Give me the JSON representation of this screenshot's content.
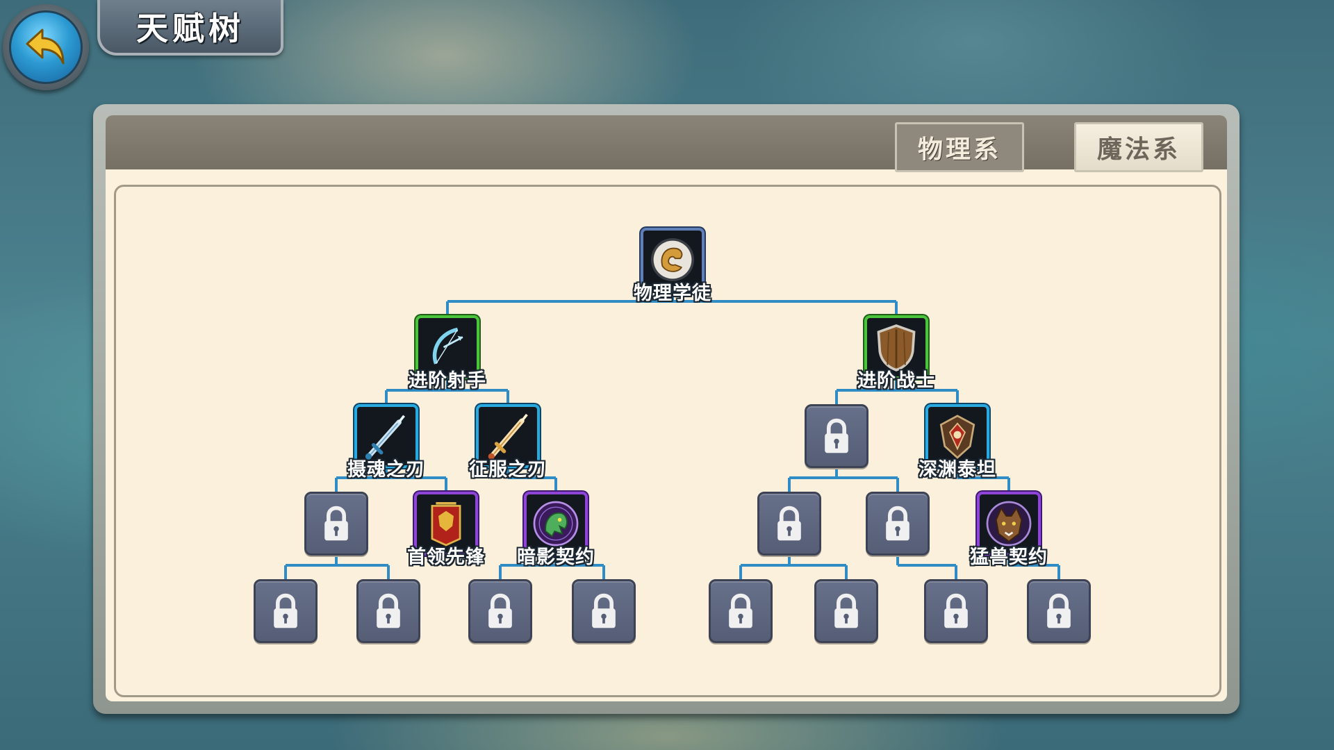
{
  "header": {
    "title": "天赋树"
  },
  "tabs": [
    {
      "label": "物理系",
      "active": true
    },
    {
      "label": "魔法系",
      "active": false
    }
  ],
  "tree": {
    "line_color": "#2f8cc4",
    "nodes": [
      {
        "id": "n1",
        "label": "物理学徒",
        "state": "unlocked",
        "frame": "blue",
        "icon": "fist-icon"
      },
      {
        "id": "n2",
        "label": "进阶射手",
        "state": "unlocked",
        "frame": "green",
        "icon": "bow-icon"
      },
      {
        "id": "n3",
        "label": "进阶战士",
        "state": "unlocked",
        "frame": "green",
        "icon": "shield-icon"
      },
      {
        "id": "n4",
        "label": "摄魂之刃",
        "state": "unlocked",
        "frame": "cyan",
        "icon": "sword-icon"
      },
      {
        "id": "n5",
        "label": "征服之刃",
        "state": "unlocked",
        "frame": "cyan",
        "icon": "golden-sword-icon"
      },
      {
        "id": "n6",
        "label": "",
        "state": "locked",
        "icon": "lock-icon"
      },
      {
        "id": "n7",
        "label": "深渊泰坦",
        "state": "unlocked",
        "frame": "cyan",
        "icon": "titan-crest-icon"
      },
      {
        "id": "n8",
        "label": "",
        "state": "locked",
        "icon": "lock-icon"
      },
      {
        "id": "n9",
        "label": "首领先锋",
        "state": "unlocked",
        "frame": "purple",
        "icon": "banner-icon"
      },
      {
        "id": "n10",
        "label": "暗影契约",
        "state": "unlocked",
        "frame": "purple",
        "icon": "dragon-icon"
      },
      {
        "id": "n11",
        "label": "",
        "state": "locked",
        "icon": "lock-icon"
      },
      {
        "id": "n12",
        "label": "",
        "state": "locked",
        "icon": "lock-icon"
      },
      {
        "id": "n13",
        "label": "猛兽契约",
        "state": "unlocked",
        "frame": "purple",
        "icon": "beast-icon"
      },
      {
        "id": "n14",
        "label": "",
        "state": "locked",
        "icon": "lock-icon"
      },
      {
        "id": "n15",
        "label": "",
        "state": "locked",
        "icon": "lock-icon"
      },
      {
        "id": "n16",
        "label": "",
        "state": "locked",
        "icon": "lock-icon"
      },
      {
        "id": "n17",
        "label": "",
        "state": "locked",
        "icon": "lock-icon"
      },
      {
        "id": "n18",
        "label": "",
        "state": "locked",
        "icon": "lock-icon"
      },
      {
        "id": "n19",
        "label": "",
        "state": "locked",
        "icon": "lock-icon"
      },
      {
        "id": "n20",
        "label": "",
        "state": "locked",
        "icon": "lock-icon"
      },
      {
        "id": "n21",
        "label": "",
        "state": "locked",
        "icon": "lock-icon"
      }
    ],
    "edges": [
      [
        "n1",
        "n2"
      ],
      [
        "n1",
        "n3"
      ],
      [
        "n2",
        "n4"
      ],
      [
        "n2",
        "n5"
      ],
      [
        "n3",
        "n6"
      ],
      [
        "n3",
        "n7"
      ],
      [
        "n4",
        "n8"
      ],
      [
        "n4",
        "n9"
      ],
      [
        "n5",
        "n10"
      ],
      [
        "n6",
        "n11"
      ],
      [
        "n6",
        "n12"
      ],
      [
        "n7",
        "n13"
      ],
      [
        "n8",
        "n14"
      ],
      [
        "n8",
        "n15"
      ],
      [
        "n10",
        "n16"
      ],
      [
        "n10",
        "n17"
      ],
      [
        "n11",
        "n18"
      ],
      [
        "n11",
        "n19"
      ],
      [
        "n12",
        "n20"
      ],
      [
        "n13",
        "n21"
      ]
    ]
  }
}
